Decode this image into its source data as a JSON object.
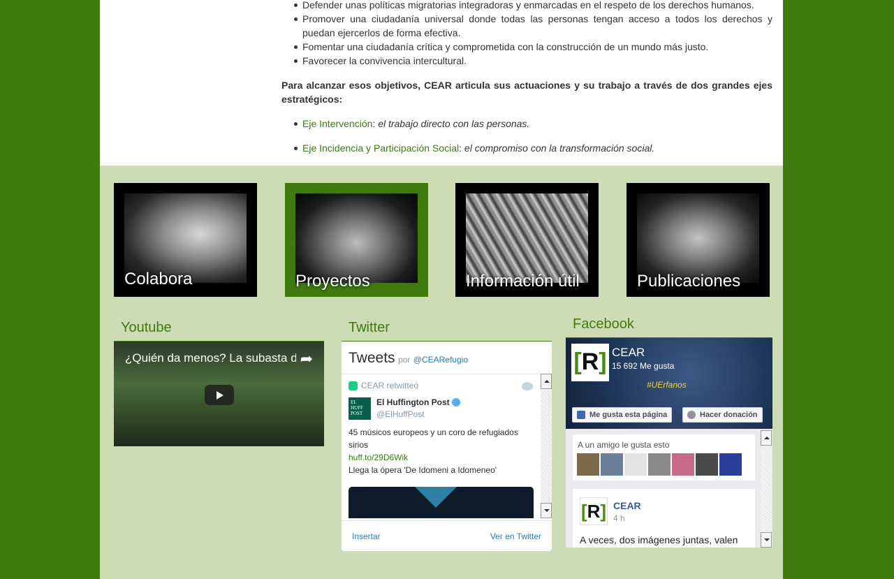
{
  "content": {
    "objectives": [
      "Defender unas políticas migratorias integradoras y enmarcadas en el respeto de los derechos humanos.",
      "Promover una ciudadanía universal donde todas las personas tengan acceso a todos los derechos y puedan ejercerlos de forma efectiva.",
      "Fomentar una ciudadanía crítica y comprometida con la construcción de un mundo más justo.",
      "Favorecer la convivencia intercultural."
    ],
    "lead": "Para alcanzar esos objetivos, CEAR articula sus actuaciones y su trabajo a través de dos grandes ejes estratégicos:",
    "axes": [
      {
        "link": "Eje Intervención",
        "sep": ": ",
        "desc": "el trabajo directo con las personas."
      },
      {
        "link": "Eje Incidencia y Participación Social",
        "sep": ": ",
        "desc": "el compromiso con la transformación social."
      }
    ]
  },
  "tiles": [
    {
      "label": "Colabora"
    },
    {
      "label": "Proyectos"
    },
    {
      "label": "Información útil"
    },
    {
      "label": "Publicaciones"
    }
  ],
  "youtube": {
    "title": "Youtube",
    "video_title": "¿Quién da menos? La subasta de la vergüenza"
  },
  "twitter": {
    "title": "Twitter",
    "header": "Tweets",
    "by": "por",
    "handle": "@CEARefugio",
    "retweet_label": "CEAR retwitteó",
    "author_name": "El Huffington Post",
    "author_handle": "@ElHuffPost",
    "logo_text": "EL HUFF POST",
    "text": "45 músicos europeos y un coro de refugiados sirios",
    "link": "huff.to/29D6Wik",
    "text2": "Llega la ópera 'De Idomeni a Idomeneo'",
    "embed": "Insertar",
    "view": "Ver en Twitter"
  },
  "facebook": {
    "title": "Facebook",
    "page_name": "CEAR",
    "likes": "15 692 Me gusta",
    "cover_tag": "#UErfanos",
    "like_button": "Me gusta esta página",
    "donate_button": "Hacer donación",
    "friend_text": "A un amigo le gusta esto",
    "post_name": "CEAR",
    "post_time": "4 h",
    "post_text": "A veces, dos imágenes juntas, valen"
  }
}
